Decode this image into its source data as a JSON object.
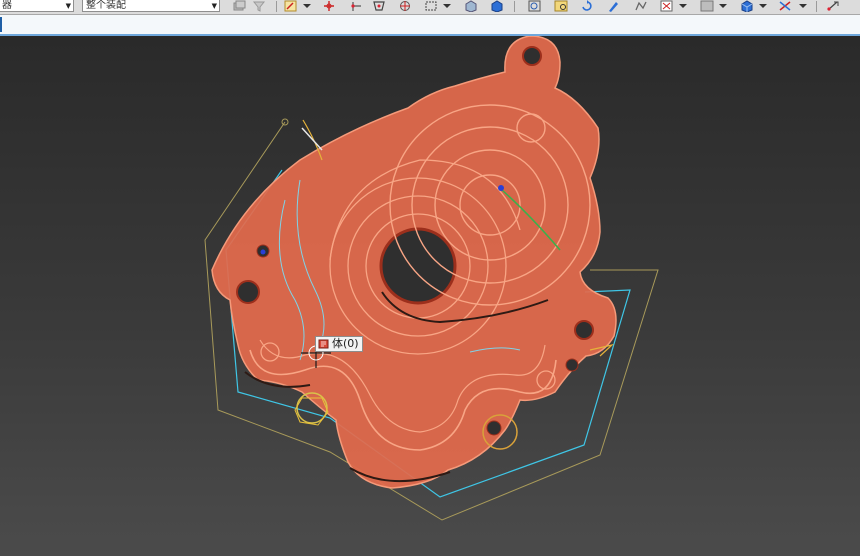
{
  "toolbar": {
    "combo_left": {
      "value": "器"
    },
    "combo_right": {
      "value": "整个装配"
    },
    "icons": [
      "layer-icon",
      "filter-icon",
      "select-face-icon",
      "snap-point-icon",
      "snap-edge-icon",
      "polygon-select-icon",
      "snap-center-icon",
      "box-select-icon",
      "view-solid-icon",
      "view-box-icon",
      "zoom-window-icon",
      "fit-view-icon",
      "rotate-view-icon",
      "brush-icon",
      "sketch-icon",
      "selection-filter-icon",
      "color-swatch-icon",
      "shaded-cube-icon",
      "wcs-icon",
      "move-icon"
    ]
  },
  "command_line": {
    "value": ""
  },
  "viewport": {
    "part_color": "#e36a4c",
    "edge_color": "#f59a7a",
    "toolpath_colors": {
      "boundary": "#a89a5a",
      "offset": "#3fc6e6"
    },
    "tooltip": {
      "label": "体(0)",
      "icon": "body-icon"
    }
  }
}
